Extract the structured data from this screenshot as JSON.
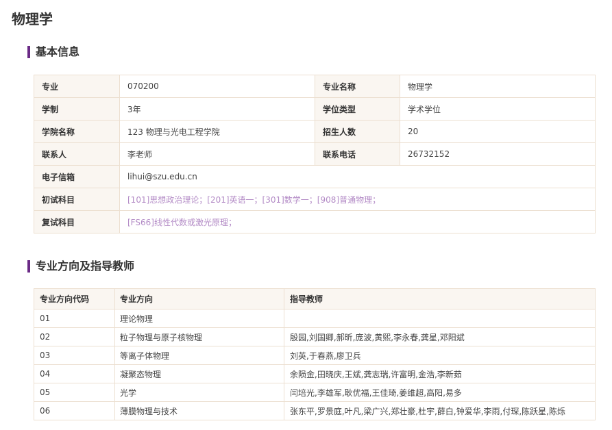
{
  "page_title": "物理学",
  "basic_info": {
    "section_title": "基本信息",
    "rows": [
      {
        "l1": "专业",
        "v1": "070200",
        "l2": "专业名称",
        "v2": "物理学"
      },
      {
        "l1": "学制",
        "v1": "3年",
        "l2": "学位类型",
        "v2": "学术学位"
      },
      {
        "l1": "学院名称",
        "v1": "123 物理与光电工程学院",
        "l2": "招生人数",
        "v2": "20"
      },
      {
        "l1": "联系人",
        "v1": "李老师",
        "l2": "联系电话",
        "v2": "26732152"
      }
    ],
    "email_label": "电子信箱",
    "email": "lihui@szu.edu.cn",
    "initial_exam_label": "初试科目",
    "initial_exam": "[101]思想政治理论；[201]英语一；[301]数学一；[908]普通物理；",
    "retest_label": "复试科目",
    "retest": "[FS66]线性代数或激光原理；"
  },
  "directions": {
    "section_title": "专业方向及指导教师",
    "headers": [
      "专业方向代码",
      "专业方向",
      "指导教师"
    ],
    "rows": [
      {
        "code": "01",
        "name": "理论物理",
        "advisors": ""
      },
      {
        "code": "02",
        "name": "粒子物理与原子核物理",
        "advisors": "殷园,刘国卿,郝昕,庞波,黄熙,李永春,龚星,邓阳斌"
      },
      {
        "code": "03",
        "name": "等离子体物理",
        "advisors": "刘英,于春燕,廖卫兵"
      },
      {
        "code": "04",
        "name": "凝聚态物理",
        "advisors": "余陨金,田晓庆,王斌,龚志瑞,许富明,金浩,李新茹"
      },
      {
        "code": "05",
        "name": "光学",
        "advisors": "闫培光,李雄军,耿优福,王佳琦,姜维超,高阳,易多"
      },
      {
        "code": "06",
        "name": "薄膜物理与技术",
        "advisors": "张东平,罗景庭,叶凡,梁广兴,郑壮豪,杜宇,薛白,钟爱华,李雨,付琛,陈跃星,陈烁"
      }
    ]
  }
}
